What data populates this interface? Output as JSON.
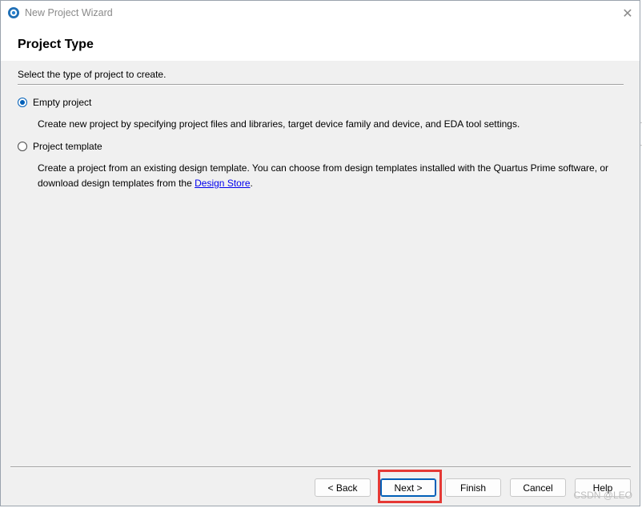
{
  "window": {
    "title": "New Project Wizard",
    "close_glyph": "✕"
  },
  "header": {
    "page_title": "Project Type"
  },
  "content": {
    "instruction": "Select the type of project to create.",
    "options": [
      {
        "label": "Empty project",
        "selected": true,
        "description": "Create new project by specifying project files and libraries, target device family and device, and EDA tool settings."
      },
      {
        "label": "Project template",
        "selected": false,
        "description_prefix": "Create a project from an existing design template. You can choose from design templates installed with the Quartus Prime software, or download design templates from the ",
        "link_text": "Design Store",
        "description_suffix": "."
      }
    ]
  },
  "buttons": {
    "back": "< Back",
    "next": "Next >",
    "finish": "Finish",
    "cancel": "Cancel",
    "help": "Help"
  },
  "watermark": "CSDN @LEO",
  "colors": {
    "accent": "#005fb8",
    "highlight_box": "#e53935",
    "link": "#0000ee"
  },
  "icons": {
    "app": "quartus-globe-icon",
    "close": "close-icon"
  }
}
